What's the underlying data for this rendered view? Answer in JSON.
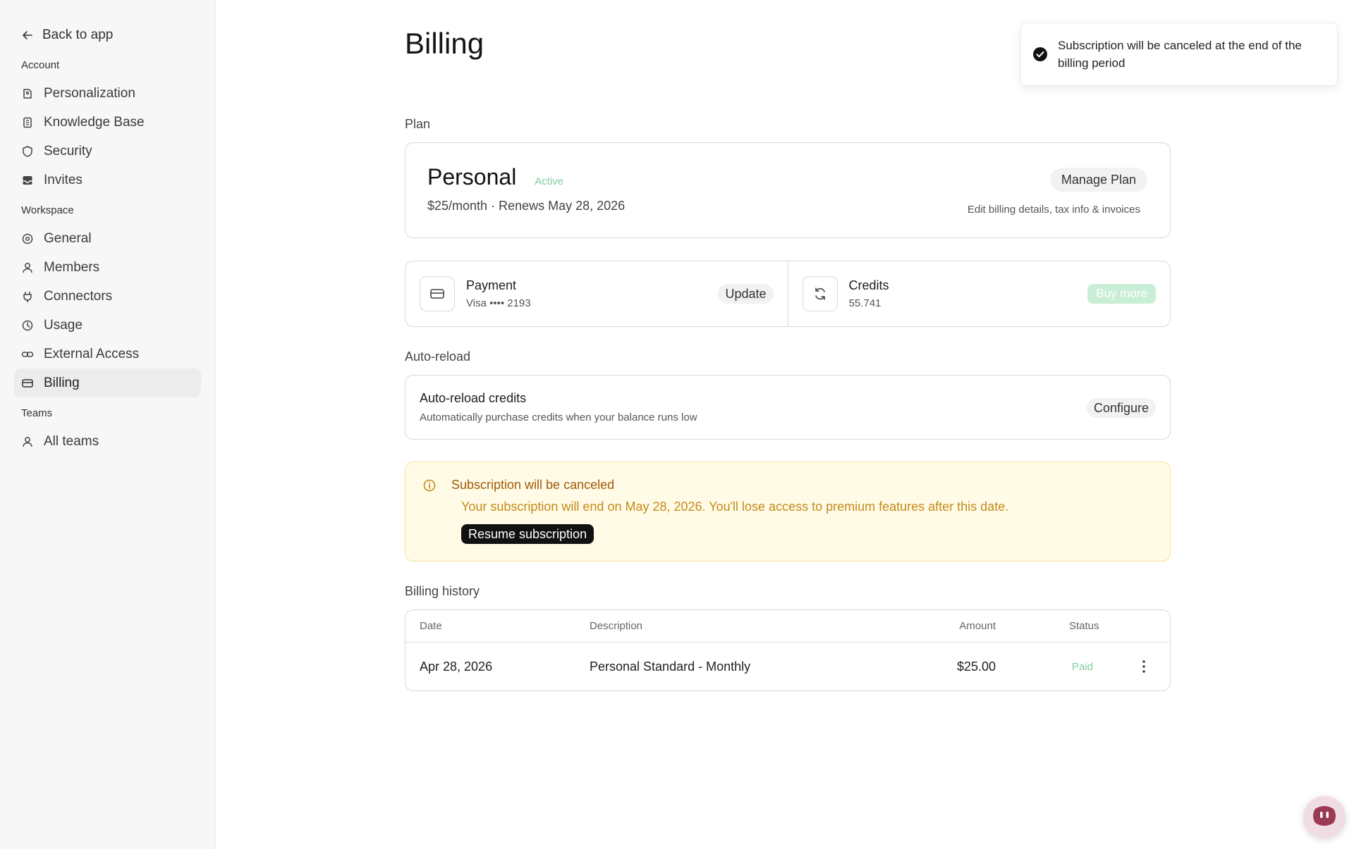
{
  "sidebar": {
    "back_label": "Back to app",
    "sections": [
      {
        "label": "Account",
        "items": [
          {
            "label": "Personalization",
            "icon": "personalization-icon"
          },
          {
            "label": "Knowledge Base",
            "icon": "book-icon"
          },
          {
            "label": "Security",
            "icon": "shield-icon"
          },
          {
            "label": "Invites",
            "icon": "inbox-icon"
          }
        ]
      },
      {
        "label": "Workspace",
        "items": [
          {
            "label": "General",
            "icon": "gear-icon"
          },
          {
            "label": "Members",
            "icon": "user-icon"
          },
          {
            "label": "Connectors",
            "icon": "plug-icon"
          },
          {
            "label": "Usage",
            "icon": "usage-icon"
          },
          {
            "label": "External Access",
            "icon": "link-icon"
          },
          {
            "label": "Billing",
            "icon": "card-icon",
            "active": true
          }
        ]
      },
      {
        "label": "Teams",
        "items": [
          {
            "label": "All teams",
            "icon": "user-icon"
          }
        ]
      }
    ]
  },
  "main": {
    "title": "Billing",
    "plan": {
      "section_label": "Plan",
      "name": "Personal",
      "status": "Active",
      "price": "$25/month · Renews May 28, 2026",
      "manage_label": "Manage Plan",
      "manage_sub": "Edit billing details, tax info & invoices"
    },
    "payment": {
      "title": "Payment",
      "sub": "Visa •••• 2193",
      "update_label": "Update"
    },
    "credits": {
      "title": "Credits",
      "sub": "55.741",
      "buy_label": "Buy more"
    },
    "auto_reload": {
      "section_label": "Auto-reload",
      "title": "Auto-reload credits",
      "sub": "Automatically purchase credits when your balance runs low",
      "configure_label": "Configure"
    },
    "warning": {
      "title": "Subscription will be canceled",
      "text": "Your subscription will end on May 28, 2026. You'll lose access to premium features after this date.",
      "resume_label": "Resume subscription"
    },
    "history": {
      "section_label": "Billing history",
      "headers": {
        "date": "Date",
        "description": "Description",
        "amount": "Amount",
        "status": "Status"
      },
      "rows": [
        {
          "date": "Apr 28, 2026",
          "description": "Personal Standard - Monthly",
          "amount": "$25.00",
          "status": "Paid"
        }
      ]
    }
  },
  "toast": {
    "text": "Subscription will be canceled at the end of the billing period"
  },
  "colors": {
    "active_green": "#7fcca0",
    "warning_title": "#a0590a",
    "warning_text": "#c58a1c",
    "warning_bg": "#fffbe6"
  }
}
